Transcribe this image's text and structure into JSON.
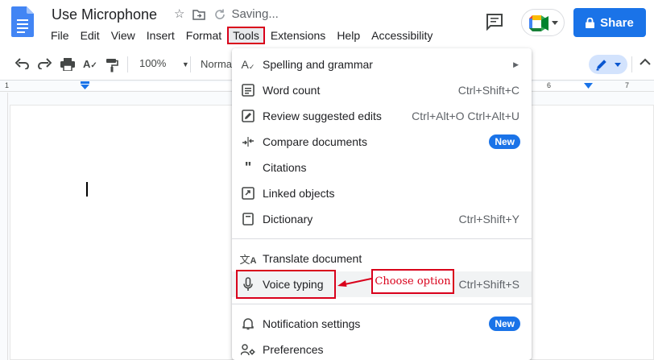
{
  "header": {
    "title": "Use Microphone",
    "saving": "Saving...",
    "share_label": "Share"
  },
  "menu": [
    "File",
    "Edit",
    "View",
    "Insert",
    "Format",
    "Tools",
    "Extensions",
    "Help",
    "Accessibility"
  ],
  "toolbar": {
    "zoom": "100%",
    "style": "Normal"
  },
  "ruler": {
    "numbers": [
      "1",
      "6",
      "7"
    ]
  },
  "dropdown": {
    "items": [
      {
        "label": "Spelling and grammar",
        "shortcut": "",
        "submenu": true,
        "icon": "spellcheck-icon"
      },
      {
        "label": "Word count",
        "shortcut": "Ctrl+Shift+C",
        "icon": "word-count-icon"
      },
      {
        "label": "Review suggested edits",
        "shortcut": "Ctrl+Alt+O Ctrl+Alt+U",
        "icon": "review-edits-icon"
      },
      {
        "label": "Compare documents",
        "badge": "New",
        "icon": "compare-icon"
      },
      {
        "label": "Citations",
        "shortcut": "",
        "icon": "quote-icon"
      },
      {
        "label": "Linked objects",
        "shortcut": "",
        "icon": "link-icon"
      },
      {
        "label": "Dictionary",
        "shortcut": "Ctrl+Shift+Y",
        "icon": "book-icon"
      },
      {
        "label": "Translate document",
        "shortcut": "",
        "icon": "translate-icon"
      },
      {
        "label": "Voice typing",
        "shortcut": "Ctrl+Shift+S",
        "icon": "microphone-icon"
      },
      {
        "label": "Notification settings",
        "badge": "New",
        "icon": "bell-icon"
      },
      {
        "label": "Preferences",
        "shortcut": "",
        "icon": "preferences-icon"
      }
    ]
  },
  "annotation": {
    "text": "Choose option"
  },
  "colors": {
    "accent": "#1a73e8",
    "annotation": "#d9001b"
  }
}
